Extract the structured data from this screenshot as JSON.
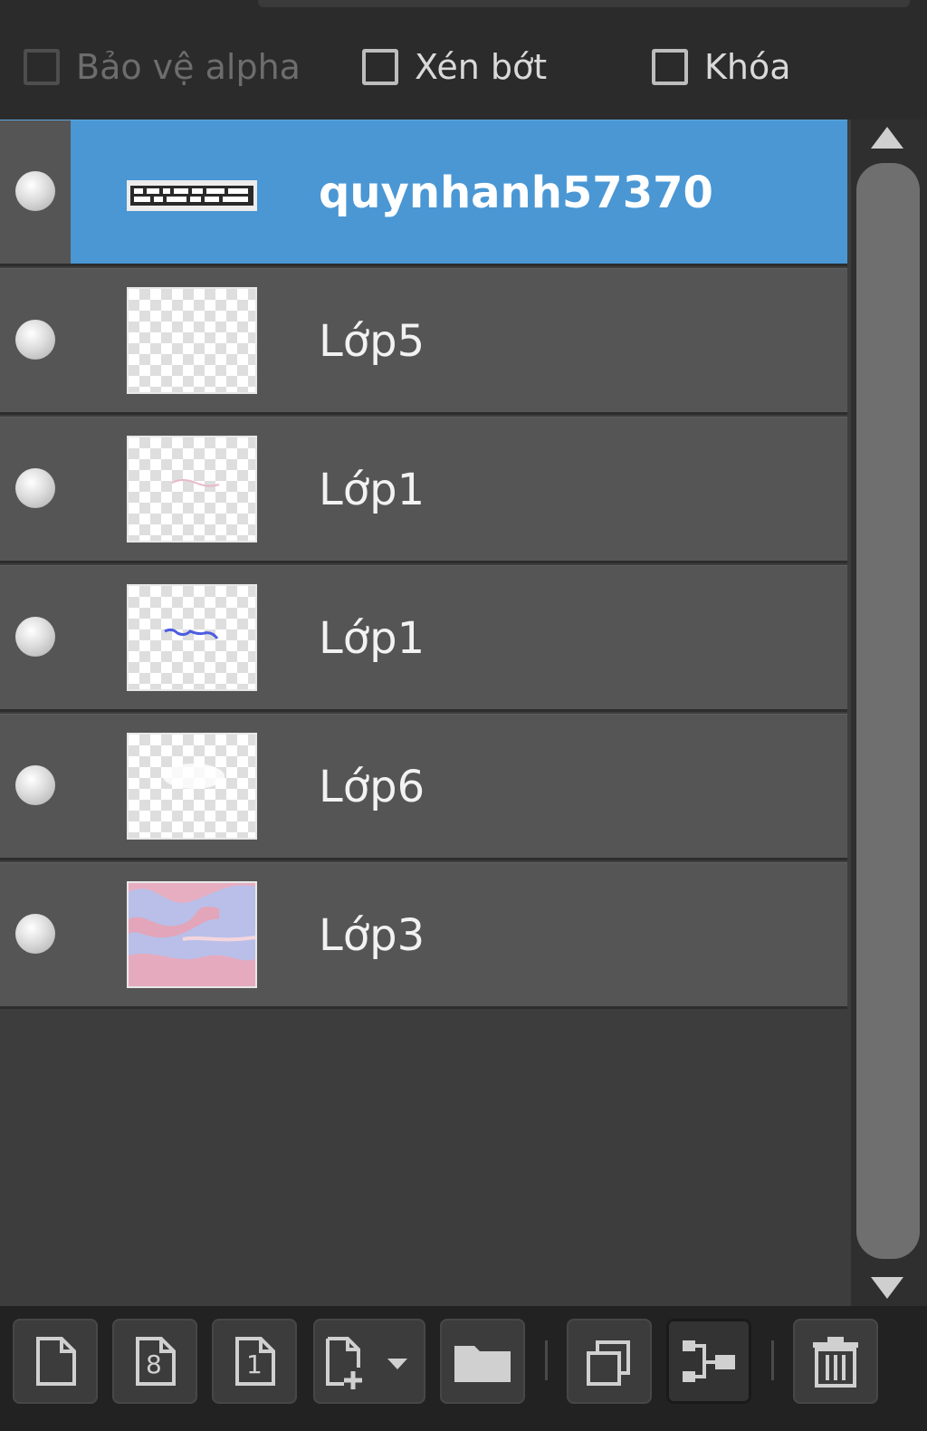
{
  "options": {
    "protect_alpha": {
      "label": "Bảo vệ alpha",
      "checked": false,
      "enabled": false
    },
    "clip": {
      "label": "Xén bớt",
      "checked": false,
      "enabled": true
    },
    "lock": {
      "label": "Khóa",
      "checked": false,
      "enabled": true
    }
  },
  "layers": [
    {
      "name": "quynhanh57370",
      "selected": true,
      "visible": true,
      "thumbnail": "text-image"
    },
    {
      "name": "Lớp5",
      "selected": false,
      "visible": true,
      "thumbnail": "transparent"
    },
    {
      "name": "Lớp1",
      "selected": false,
      "visible": true,
      "thumbnail": "transparent"
    },
    {
      "name": "Lớp1",
      "selected": false,
      "visible": true,
      "thumbnail": "transparent-with-blue-text"
    },
    {
      "name": "Lớp6",
      "selected": false,
      "visible": true,
      "thumbnail": "transparent"
    },
    {
      "name": "Lớp3",
      "selected": false,
      "visible": true,
      "thumbnail": "pink-blue-paint"
    }
  ],
  "toolbar": {
    "buttons": [
      {
        "icon": "new-layer-icon"
      },
      {
        "icon": "new-8bit-layer-icon",
        "glyph": "8"
      },
      {
        "icon": "new-1bit-layer-icon",
        "glyph": "1"
      },
      {
        "icon": "add-layer-dropdown-icon"
      },
      {
        "icon": "folder-icon"
      },
      {
        "icon": "duplicate-layer-icon"
      },
      {
        "icon": "merge-layer-icon"
      },
      {
        "icon": "trash-icon"
      }
    ]
  },
  "colors": {
    "selection": "#4a97d4",
    "panel": "#2b2b2b",
    "row": "#555555"
  }
}
